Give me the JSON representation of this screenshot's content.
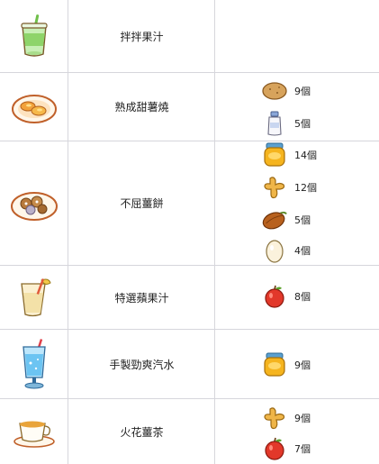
{
  "rows": [
    {
      "name": "拌拌果汁",
      "dish_icon": "green-smoothie-icon",
      "materials": []
    },
    {
      "name": "熟成甜薯燒",
      "dish_icon": "sweet-potato-dish-icon",
      "materials": [
        {
          "icon": "potato-icon",
          "count": "9個"
        },
        {
          "icon": "milk-bottle-icon",
          "count": "5個"
        }
      ]
    },
    {
      "name": "不屈薑餅",
      "dish_icon": "gingerbread-plate-icon",
      "materials": [
        {
          "icon": "honey-jar-icon",
          "count": "14個"
        },
        {
          "icon": "ginger-icon",
          "count": "12個"
        },
        {
          "icon": "cacao-pod-icon",
          "count": "5個"
        },
        {
          "icon": "egg-icon",
          "count": "4個"
        }
      ]
    },
    {
      "name": "特選蘋果汁",
      "dish_icon": "apple-juice-glass-icon",
      "materials": [
        {
          "icon": "apple-icon",
          "count": "8個"
        }
      ]
    },
    {
      "name": "手製勁爽汽水",
      "dish_icon": "soda-glass-icon",
      "materials": [
        {
          "icon": "honey-jar-icon",
          "count": "9個"
        }
      ]
    },
    {
      "name": "火花薑茶",
      "dish_icon": "ginger-tea-cup-icon",
      "materials": [
        {
          "icon": "ginger-icon",
          "count": "9個"
        },
        {
          "icon": "apple-icon",
          "count": "7個"
        }
      ]
    }
  ]
}
